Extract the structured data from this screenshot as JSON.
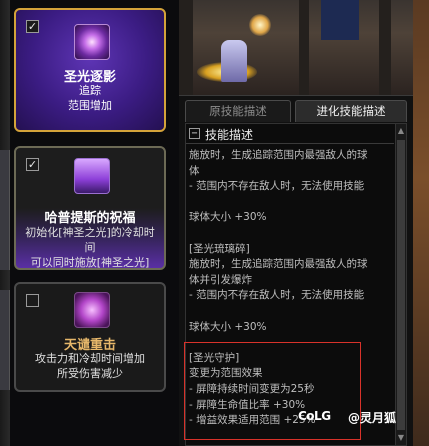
{
  "skills": [
    {
      "checked": true,
      "name": "圣光逐影",
      "desc_lines": [
        "追踪",
        "范围增加"
      ],
      "icon": "holy-orb-icon"
    },
    {
      "checked": true,
      "name": "哈普提斯的祝福",
      "desc_lines": [
        "初始化[神圣之光]的冷却时",
        "间",
        "可以同时施放[神圣之光]"
      ],
      "icon": "blessing-icon"
    },
    {
      "checked": false,
      "name": "天谴重击",
      "desc_lines": [
        "攻击力和冷却时间增加",
        "所受伤害减少"
      ],
      "icon": "divine-strike-icon"
    }
  ],
  "tabs": {
    "original": "原技能描述",
    "evolved": "进化技能描述"
  },
  "description": {
    "header": "技能描述",
    "lines": [
      "施放时，生成追踪范围内最强敌人的球",
      "体",
      "- 范围内不存在敌人时，无法使用技能",
      "",
      "球体大小 +30%",
      "",
      "[圣光琉璃碎]",
      "施放时，生成追踪范围内最强敌人的球",
      "体并引发爆炸",
      "- 范围内不存在敌人时，无法使用技能",
      "",
      "球体大小 +30%",
      "",
      "[圣光守护]",
      "变更为范围效果",
      "- 屏障持续时间变更为25秒",
      "- 屏障生命值比率 +30%",
      "- 增益效果适用范围 +25%"
    ]
  },
  "watermark": {
    "logo": "CoLG",
    "handle": "@灵月狐"
  },
  "colors": {
    "selected_border": "#d4a33a",
    "highlight_border": "#d8322a",
    "card_purple": "#3b1c83"
  }
}
